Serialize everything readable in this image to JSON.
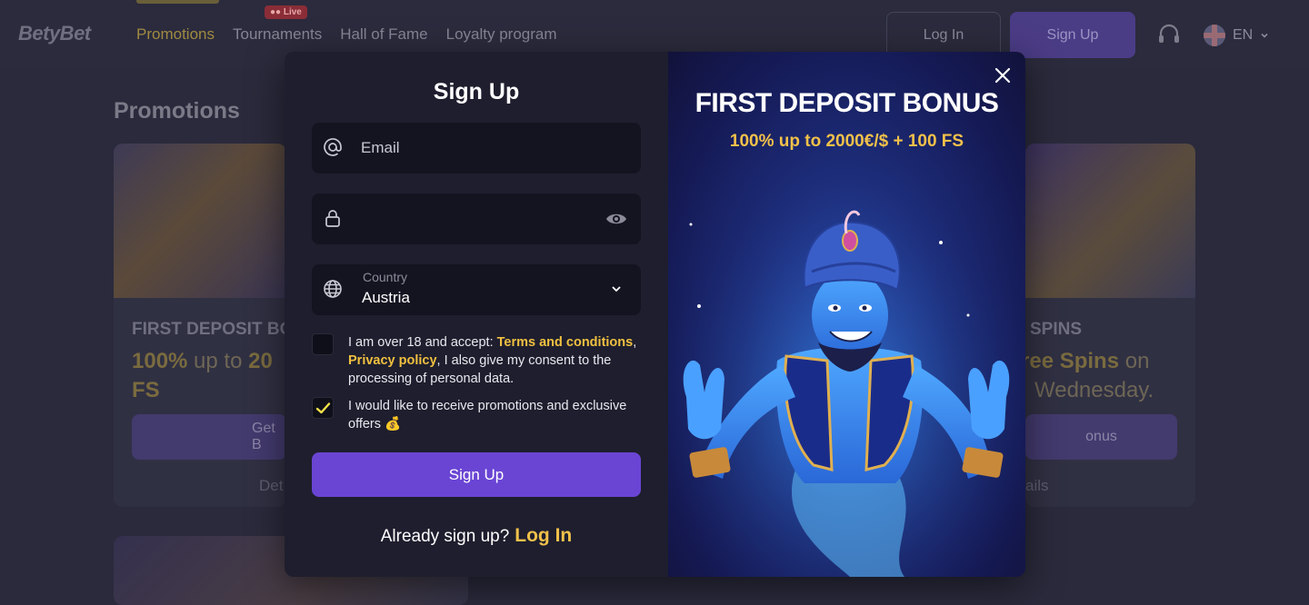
{
  "header": {
    "logo": "BetyBet",
    "nav": [
      {
        "label": "Promotions",
        "active": true
      },
      {
        "label": "Tournaments",
        "active": false
      },
      {
        "label": "Hall of Fame",
        "active": false
      },
      {
        "label": "Loyalty program",
        "active": false
      }
    ],
    "live_badge": "Live",
    "login_label": "Log In",
    "signup_label": "Sign Up",
    "language": "EN"
  },
  "page": {
    "title": "Promotions",
    "cards": [
      {
        "heading": "FIRST DEPOSIT BO",
        "sub_bold": "100%",
        "sub_text": " up to ",
        "sub_bold2": "20",
        "sub_line2": "FS",
        "button": "Get B",
        "link": "Det"
      },
      {
        "heading": "SPINS",
        "sub_bold": "ree Spins",
        "sub_text": " on",
        "sub_line2": "Wednesday.",
        "button": "onus",
        "link": "ails"
      }
    ]
  },
  "modal": {
    "title": "Sign Up",
    "email_placeholder": "Email",
    "password_value": "",
    "country_label": "Country",
    "country_value": "Austria",
    "terms": {
      "prefix": "I am over 18 and accept: ",
      "terms_link": "Terms and conditions",
      "sep": ", ",
      "privacy_link": "Privacy policy",
      "suffix": ", I also give my consent to the processing of personal data.",
      "checked": false
    },
    "promo_optin": {
      "text": "I would like to receive promotions and exclusive offers 💰",
      "checked": true
    },
    "submit_label": "Sign Up",
    "footer_text": "Already sign up?",
    "footer_link": "Log In"
  },
  "promo": {
    "title": "FIRST DEPOSIT BONUS",
    "subtitle": "100% up to 2000€/$ + 100 FS"
  },
  "colors": {
    "accent": "#6a45d4",
    "highlight": "#f2c14a",
    "modal_bg": "#1e1e2e",
    "field_bg": "#141421"
  }
}
